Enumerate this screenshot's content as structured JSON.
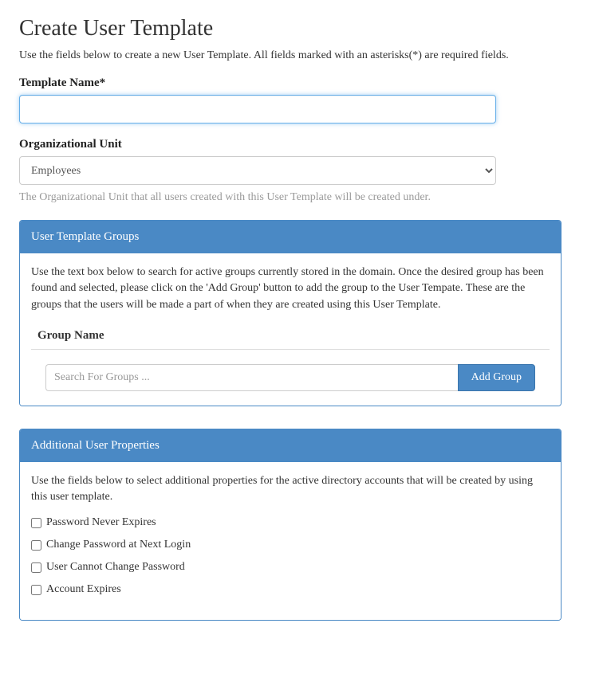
{
  "page": {
    "title": "Create User Template",
    "intro": "Use the fields below to create a new User Template. All fields marked with an asterisks(*) are required fields."
  },
  "template_name": {
    "label": "Template Name*",
    "value": ""
  },
  "org_unit": {
    "label": "Organizational Unit",
    "selected": "Employees",
    "help": "The Organizational Unit that all users created with this User Template will be created under."
  },
  "groups_panel": {
    "title": "User Template Groups",
    "description": "Use the text box below to search for active groups currently stored in the domain. Once the desired group has been found and selected, please click on the 'Add Group' button to add the group to the User Tempate. These are the groups that the users will be made a part of when they are created using this User Template.",
    "col_header": "Group Name",
    "search_placeholder": "Search For Groups ...",
    "add_button": "Add Group"
  },
  "props_panel": {
    "title": "Additional User Properties",
    "description": "Use the fields below to select additional properties for the active directory accounts that will be created by using this user template.",
    "options": [
      "Password Never Expires",
      "Change Password at Next Login",
      "User Cannot Change Password",
      "Account Expires"
    ]
  }
}
